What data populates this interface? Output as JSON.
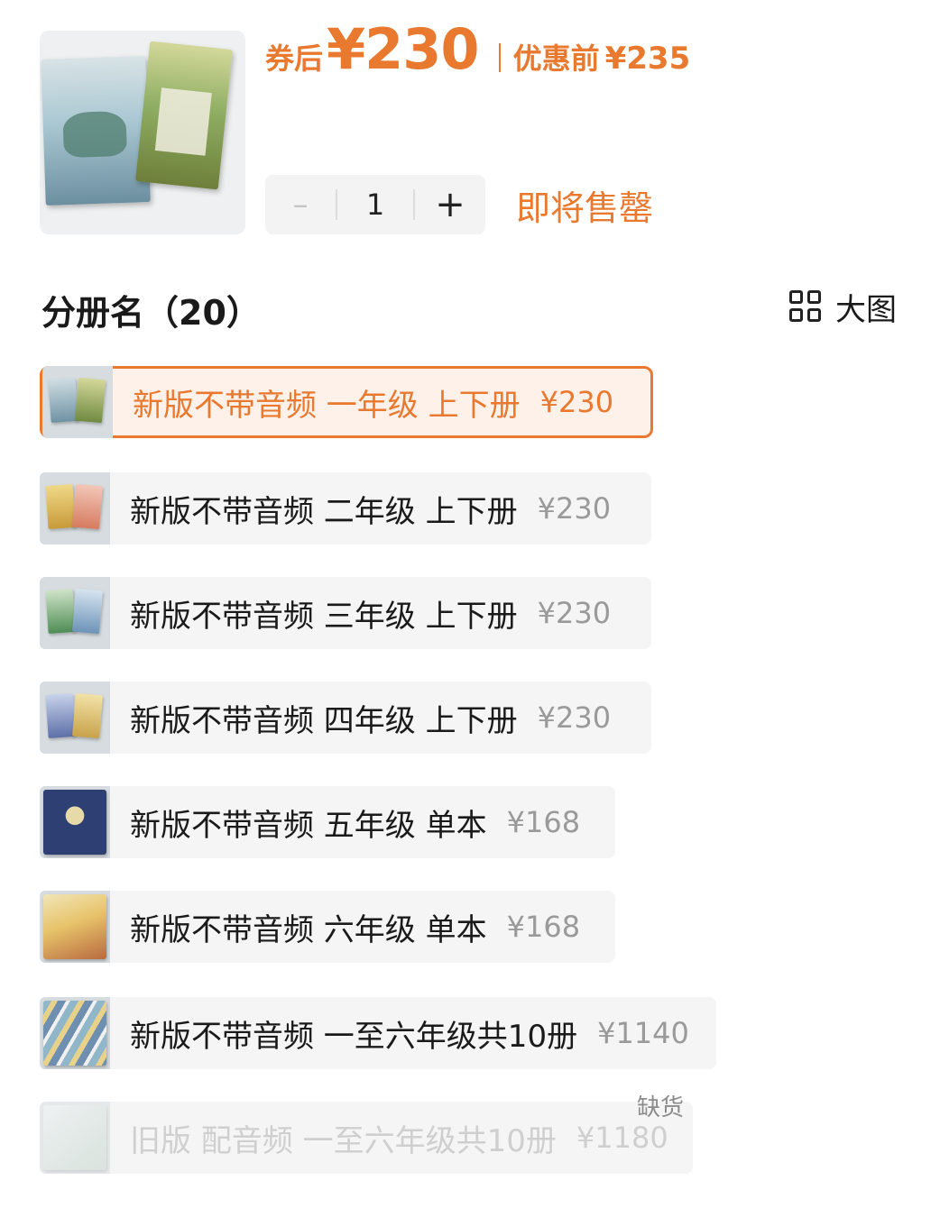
{
  "product": {
    "image_icon": "textbook-set-photo",
    "price_after_label": "券后",
    "price_after_value": "¥230",
    "price_before_label": "优惠前",
    "price_before_value": "¥235",
    "accent_color": "#e8792f"
  },
  "quantity": {
    "minus": "–",
    "value": "1",
    "plus": "+"
  },
  "stock_status": "即将售罄",
  "variants": {
    "title": "分册名（20）",
    "view_toggle_label": "大图",
    "view_toggle_icon": "grid-icon",
    "items": [
      {
        "name": "新版不带音频 一年级 上下册",
        "price": "¥230",
        "selected": true
      },
      {
        "name": "新版不带音频 二年级 上下册",
        "price": "¥230"
      },
      {
        "name": "新版不带音频 三年级 上下册",
        "price": "¥230"
      },
      {
        "name": "新版不带音频 四年级 上下册",
        "price": "¥230"
      },
      {
        "name": "新版不带音频 五年级 单本",
        "price": "¥168"
      },
      {
        "name": "新版不带音频 六年级 单本",
        "price": "¥168"
      },
      {
        "name": "新版不带音频 一至六年级共10册",
        "price": "¥1140"
      },
      {
        "name": "旧版 配音频 一至六年级共10册",
        "price": "¥1180",
        "disabled": true,
        "tag": "缺货"
      }
    ]
  }
}
